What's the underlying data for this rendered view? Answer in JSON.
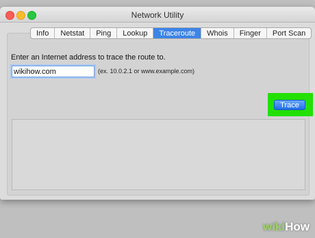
{
  "window": {
    "title": "Network Utility"
  },
  "tabs": [
    {
      "label": "Info",
      "active": false
    },
    {
      "label": "Netstat",
      "active": false
    },
    {
      "label": "Ping",
      "active": false
    },
    {
      "label": "Lookup",
      "active": false
    },
    {
      "label": "Traceroute",
      "active": true
    },
    {
      "label": "Whois",
      "active": false
    },
    {
      "label": "Finger",
      "active": false
    },
    {
      "label": "Port Scan",
      "active": false
    }
  ],
  "traceroute": {
    "prompt": "Enter an Internet address to trace the route to.",
    "address_value": "wikihow.com",
    "hint": "(ex. 10.0.2.1 or www.example.com)",
    "trace_label": "Trace",
    "output": ""
  },
  "watermark": {
    "prefix": "wiki",
    "suffix": "How"
  },
  "colors": {
    "active_tab": "#3d84e6",
    "trace_highlight": "#22e000",
    "button_blue": "#1f6fe5"
  }
}
